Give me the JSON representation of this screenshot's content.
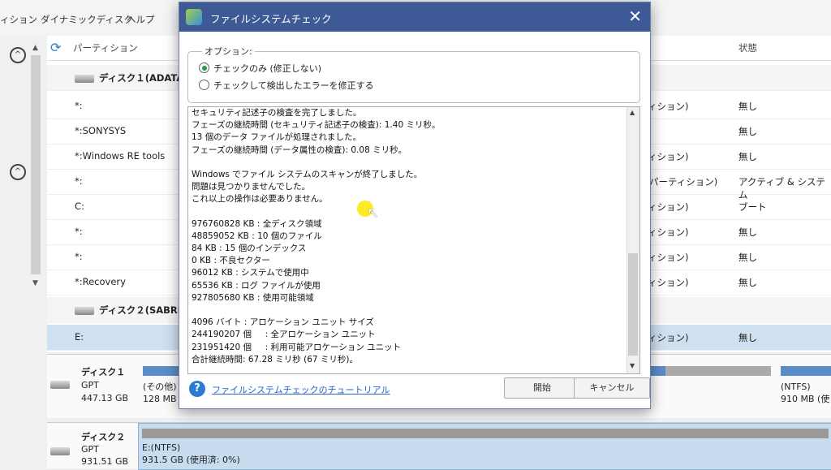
{
  "menu": {
    "items": [
      "ィション",
      "ダイナミックディスク",
      "ヘルプ"
    ]
  },
  "table": {
    "header": {
      "partition": "パーティション",
      "status": "状態"
    },
    "rows": [
      {
        "kind": "disk",
        "name": "ディスク１(ADATA"
      },
      {
        "name": "*:",
        "type": "ィション)",
        "status": "無し"
      },
      {
        "name": "*:SONYSYS",
        "type": "",
        "status": "無し"
      },
      {
        "name": "*:Windows RE tools",
        "type": "ィション)",
        "status": "無し"
      },
      {
        "name": "*:",
        "type": "パーティション)",
        "status": "アクティブ & システム"
      },
      {
        "name": "C:",
        "type": "ィション)",
        "status": "ブート"
      },
      {
        "name": "*:",
        "type": "ィション)",
        "status": "無し"
      },
      {
        "name": "*:",
        "type": "ィション)",
        "status": "無し"
      },
      {
        "name": "*:Recovery",
        "type": "ィション)",
        "status": "無し"
      },
      {
        "kind": "disk",
        "name": "ディスク２(SABREN"
      },
      {
        "name": "E:",
        "type": "ィション)",
        "status": "無し",
        "selected": true
      }
    ]
  },
  "diskmap": {
    "disk1": {
      "name": "ディスク１",
      "style": "GPT",
      "size": "447.13 GB",
      "p1a": "(その他)",
      "p1b": "128 MB",
      "plast_a": "(NTFS)",
      "plast_b": "910 MB (使"
    },
    "disk2": {
      "name": "ディスク２",
      "style": "GPT",
      "size": "931.51 GB",
      "p1a": "E:(NTFS)",
      "p1b": "931.5 GB (使用済: 0%)"
    }
  },
  "dialog": {
    "title": "ファイルシステムチェック",
    "options_legend": "オプション:",
    "option1": "チェックのみ (修正しない)",
    "option2": "チェックして検出したエラーを修正する",
    "selected_option": 1,
    "log_lines": [
      "セキュリティ記述子の検査を完了しました。",
      "フェーズの継続時間 (セキュリティ記述子の検査): 1.40 ミリ秒。",
      "13 個のデータ ファイルが処理されました。",
      "フェーズの継続時間 (データ属性の検査): 0.08 ミリ秒。",
      "",
      "Windows でファイル システムのスキャンが終了しました。",
      "問題は見つかりませんでした。",
      "これ以上の操作は必要ありません。",
      "",
      "976760828 KB : 全ディスク領域",
      "48859052 KB : 10 個のファイル",
      "84 KB : 15 個のインデックス",
      "0 KB : 不良セクター",
      "96012 KB : システムで使用中",
      "65536 KB : ログ ファイルが使用",
      "927805680 KB : 使用可能領域",
      "",
      "4096 バイト : アロケーション ユニット サイズ",
      "244190207 個     : 全アロケーション ユニット",
      "231951420 個     : 利用可能アロケーション ユニット",
      "合計継続時間: 67.28 ミリ秒 (67 ミリ秒)。"
    ],
    "help_link": "ファイルシステムチェックのチュートリアル",
    "start_button": "開始",
    "cancel_button": "キャンセル"
  }
}
